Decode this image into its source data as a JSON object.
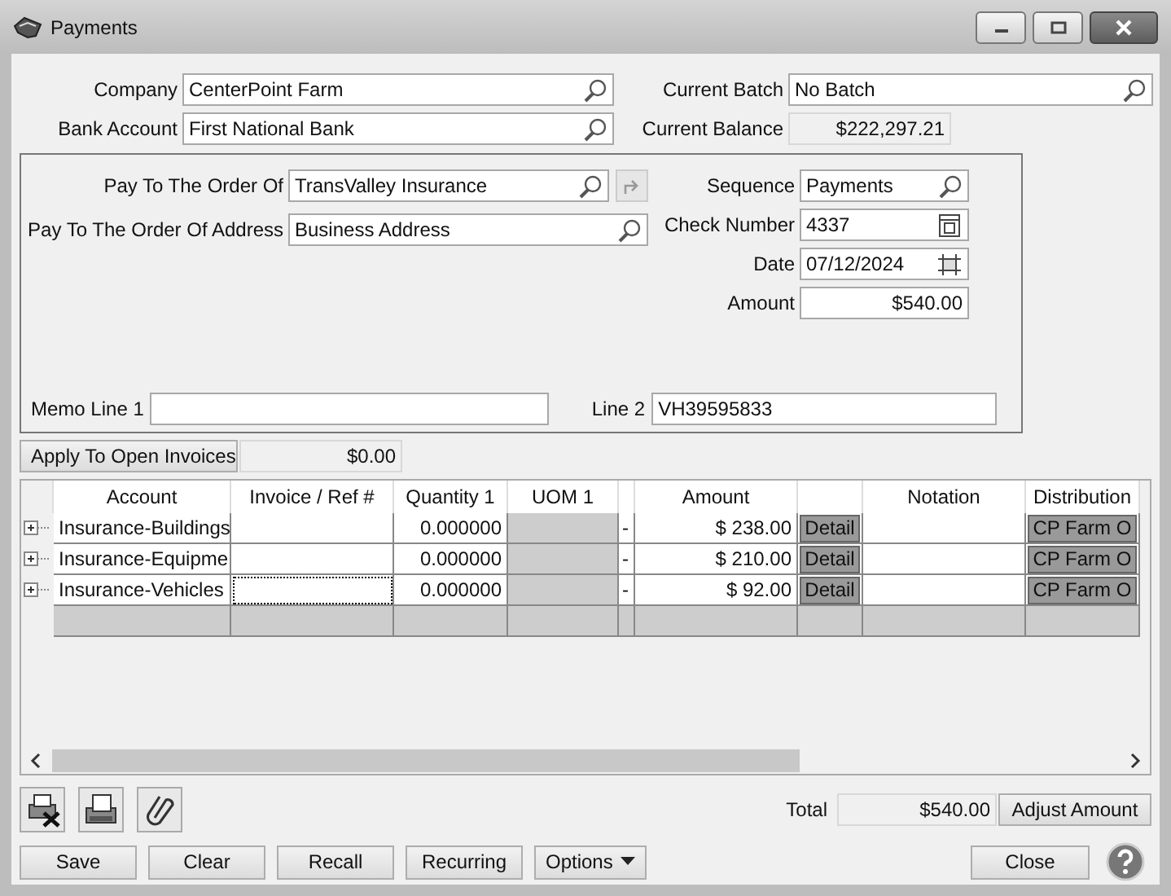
{
  "window": {
    "title": "Payments"
  },
  "header": {
    "company": {
      "label": "Company",
      "value": "CenterPoint Farm"
    },
    "bank_account": {
      "label": "Bank Account",
      "value": "First National Bank"
    },
    "current_batch": {
      "label": "Current Batch",
      "value": "No Batch"
    },
    "current_balance": {
      "label": "Current Balance",
      "value": "$222,297.21"
    }
  },
  "payee": {
    "pay_to": {
      "label": "Pay To The Order Of",
      "value": "TransValley Insurance"
    },
    "address": {
      "label": "Pay To The Order Of Address",
      "value": "Business Address"
    },
    "sequence": {
      "label": "Sequence",
      "value": "Payments"
    },
    "check_number": {
      "label": "Check Number",
      "value": "4337"
    },
    "date": {
      "label": "Date",
      "value": "07/12/2024"
    },
    "amount": {
      "label": "Amount",
      "value": "$540.00"
    },
    "memo_line_1": {
      "label": "Memo Line 1"
    },
    "line_2": {
      "label": "Line 2",
      "value": "VH39595833"
    }
  },
  "apply": {
    "label": "Apply To Open Invoices",
    "value": "$0.00"
  },
  "table": {
    "columns": [
      "Account",
      "Invoice / Ref #",
      "Quantity 1",
      "UOM 1",
      "Amount",
      "Notation",
      "Distribution"
    ],
    "rows": [
      {
        "account": "Insurance-Buildings",
        "invoice_focused": false,
        "quantity": "0.000000",
        "dash": "-",
        "amount": "$ 238.00",
        "detail": "Detail",
        "distribution": "CP Farm O"
      },
      {
        "account": "Insurance-Equipme",
        "invoice_focused": false,
        "quantity": "0.000000",
        "dash": "-",
        "amount": "$ 210.00",
        "detail": "Detail",
        "distribution": "CP Farm O"
      },
      {
        "account": "Insurance-Vehicles",
        "invoice_focused": true,
        "quantity": "0.000000",
        "dash": "-",
        "amount": "$ 92.00",
        "detail": "Detail",
        "distribution": "CP Farm O"
      }
    ]
  },
  "total": {
    "label": "Total",
    "value": "$540.00"
  },
  "adjust_button": "Adjust Amount",
  "buttons": [
    {
      "label": "Save",
      "kind": "plain"
    },
    {
      "label": "Clear",
      "kind": "plain"
    },
    {
      "label": "Recall",
      "kind": "plain"
    },
    {
      "label": "Recurring",
      "kind": "plain"
    },
    {
      "label": "Options",
      "kind": "dropdown"
    }
  ],
  "close_button": "Close"
}
